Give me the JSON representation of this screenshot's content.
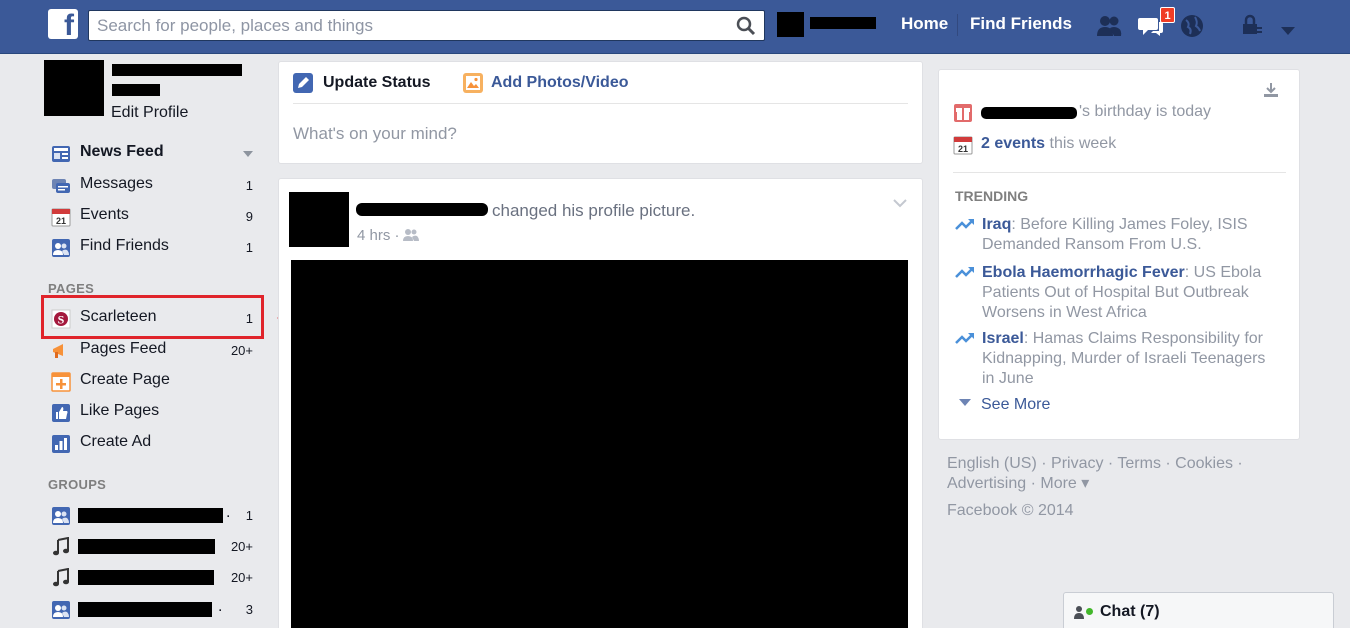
{
  "topbar": {
    "logo_text": "f",
    "search_placeholder": "Search for people, places and things",
    "home_label": "Home",
    "find_friends_label": "Find Friends",
    "messages_badge": "1",
    "brand_color": "#3b5998"
  },
  "profile": {
    "edit_label": "Edit Profile"
  },
  "left_nav": {
    "main": [
      {
        "label": "News Feed",
        "count": "",
        "icon": "news-feed-icon"
      },
      {
        "label": "Messages",
        "count": "1",
        "icon": "messages-icon"
      },
      {
        "label": "Events",
        "count": "9",
        "icon": "events-icon"
      },
      {
        "label": "Find Friends",
        "count": "1",
        "icon": "find-friends-icon"
      }
    ],
    "pages_label": "PAGES",
    "pages": [
      {
        "label": "Scarleteen",
        "count": "1",
        "icon": "scarleteen-page-icon"
      },
      {
        "label": "Pages Feed",
        "count": "20+",
        "icon": "pages-feed-icon"
      },
      {
        "label": "Create Page",
        "count": "",
        "icon": "create-page-icon"
      },
      {
        "label": "Like Pages",
        "count": "",
        "icon": "like-pages-icon"
      },
      {
        "label": "Create Ad",
        "count": "",
        "icon": "create-ad-icon"
      }
    ],
    "groups_label": "GROUPS",
    "groups": [
      {
        "count": "1",
        "icon": "group-icon"
      },
      {
        "count": "20+",
        "icon": "music-icon"
      },
      {
        "count": "20+",
        "icon": "music-icon"
      },
      {
        "count": "3",
        "icon": "group-icon"
      }
    ],
    "highlight_color": "#e0242b"
  },
  "composer": {
    "update_status_label": "Update Status",
    "add_photos_label": "Add Photos/Video",
    "placeholder": "What's on your mind?"
  },
  "story": {
    "action_text": "changed his profile picture.",
    "time_text": "4 hrs ·"
  },
  "right_column": {
    "birthday_suffix": "'s birthday is today",
    "events_count": "2 events",
    "events_suffix": " this week",
    "trending_label": "TRENDING",
    "trending": [
      {
        "topic": "Iraq",
        "text": ": Before Killing James Foley, ISIS Demanded Ransom From U.S."
      },
      {
        "topic": "Ebola Haemorrhagic Fever",
        "text": ": US Ebola Patients Out of Hospital But Outbreak Worsens in West Africa"
      },
      {
        "topic": "Israel",
        "text": ": Hamas Claims Responsibility for Kidnapping, Murder of Israeli Teenagers in June"
      }
    ],
    "see_more_label": "See More"
  },
  "footer": {
    "links_line1": "English (US) · Privacy · Terms · Cookies ·",
    "links_line2": "Advertising · More ▾",
    "copyright": "Facebook © 2014"
  },
  "chat": {
    "label": "Chat (7)"
  }
}
